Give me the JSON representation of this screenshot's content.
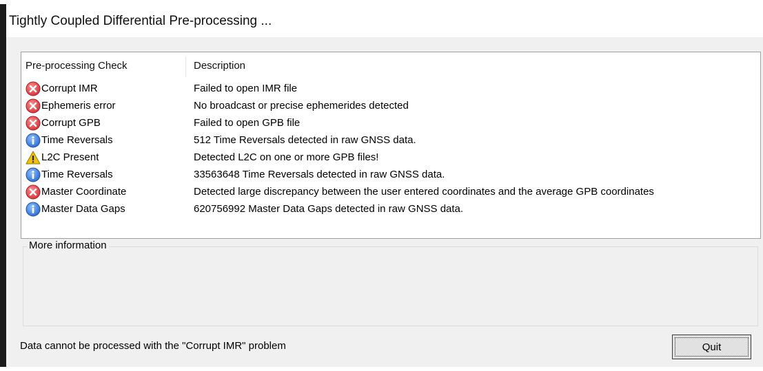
{
  "window": {
    "title": "Tightly Coupled Differential Pre-processing ..."
  },
  "list": {
    "headers": {
      "check": "Pre-processing Check",
      "description": "Description"
    },
    "rows": [
      {
        "icon": "error-icon",
        "check": "Corrupt IMR",
        "description": "Failed to open IMR file"
      },
      {
        "icon": "error-icon",
        "check": "Ephemeris error",
        "description": "No broadcast or precise ephemerides detected"
      },
      {
        "icon": "error-icon",
        "check": "Corrupt GPB",
        "description": "Failed to open GPB file"
      },
      {
        "icon": "info-icon",
        "check": "Time Reversals",
        "description": "512 Time Reversals detected in raw GNSS data."
      },
      {
        "icon": "warning-icon",
        "check": "L2C Present",
        "description": "Detected L2C on one or more GPB files!"
      },
      {
        "icon": "info-icon",
        "check": "Time Reversals",
        "description": "33563648 Time Reversals detected in raw GNSS data."
      },
      {
        "icon": "error-icon",
        "check": "Master Coordinate",
        "description": "Detected large discrepancy between the user entered coordinates and the average GPB coordinates"
      },
      {
        "icon": "info-icon",
        "check": "Master Data Gaps",
        "description": "620756992 Master Data Gaps detected in raw GNSS data."
      }
    ]
  },
  "more_info": {
    "label": "More information"
  },
  "status": {
    "text": "Data cannot be processed with the \"Corrupt IMR\" problem"
  },
  "buttons": {
    "quit_label": "Quit"
  },
  "colors": {
    "error": "#d9363e",
    "info": "#2f6fd6",
    "warning": "#f2c200"
  }
}
